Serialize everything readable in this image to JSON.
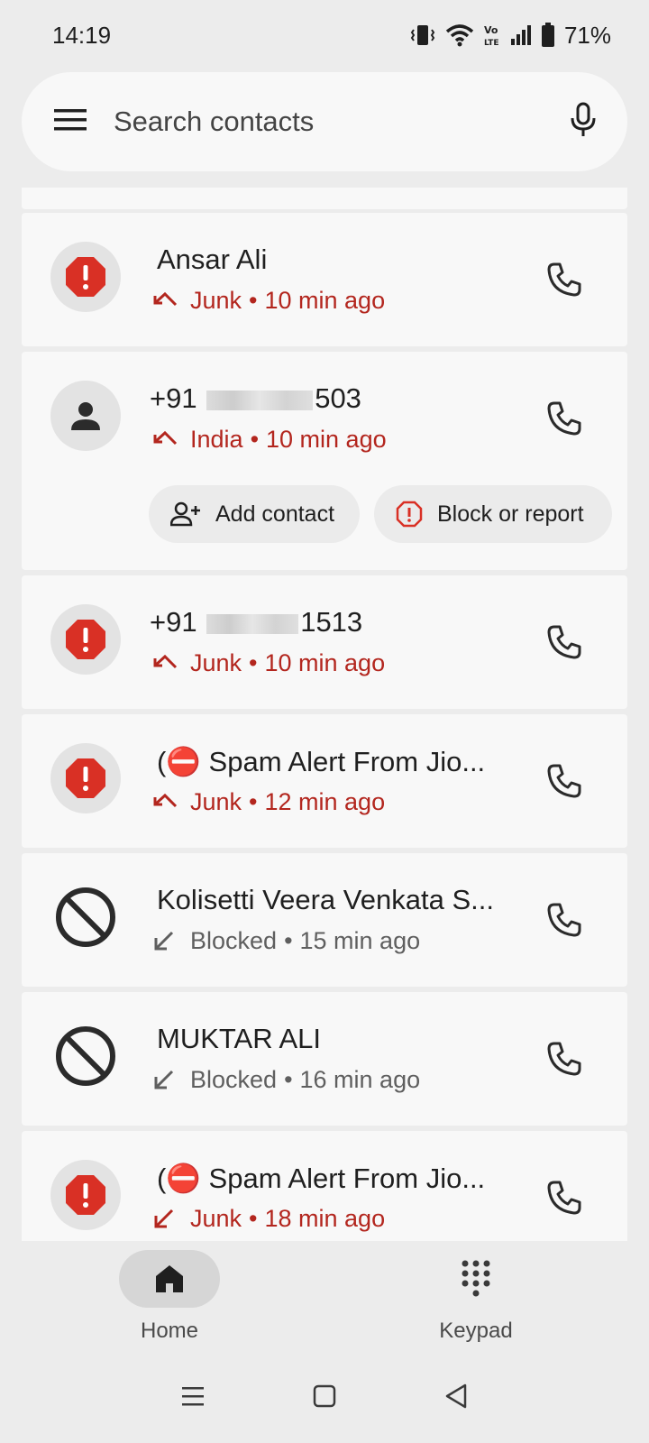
{
  "status_bar": {
    "time": "14:19",
    "battery": "71%",
    "icons": [
      "vibrate-icon",
      "wifi-icon",
      "volte-icon",
      "signal-icon",
      "battery-icon"
    ]
  },
  "search": {
    "placeholder": "Search contacts",
    "menu_icon": "menu-icon",
    "mic_icon": "mic-icon"
  },
  "calls": [
    {
      "name": "Ansar Ali",
      "label": "Junk",
      "time": "10 min ago",
      "type": "junk"
    },
    {
      "name_prefix": "+91 ",
      "name_suffix": "503",
      "label": "India",
      "time": "10 min ago",
      "type": "unknown",
      "actions": {
        "add_contact": "Add contact",
        "block_report": "Block or report"
      }
    },
    {
      "name_prefix": "+91 ",
      "name_suffix": "1513",
      "label": "Junk",
      "time": "10 min ago",
      "type": "junk"
    },
    {
      "name": "(⛔ Spam Alert From Jio...",
      "label": "Junk",
      "time": "12 min ago",
      "type": "junk"
    },
    {
      "name": "Kolisetti Veera Venkata S...",
      "label": "Blocked",
      "time": "15 min ago",
      "type": "blocked"
    },
    {
      "name": "MUKTAR ALI",
      "label": "Blocked",
      "time": "16 min ago",
      "type": "blocked"
    },
    {
      "name": "(⛔ Spam Alert From Jio...",
      "label": "Junk",
      "time": "18 min ago",
      "type": "junk"
    }
  ],
  "separator": "•",
  "nav": {
    "home": "Home",
    "keypad": "Keypad"
  },
  "colors": {
    "junk_red": "#b3261e",
    "alert_red": "#d93025",
    "card_bg": "#f8f8f8",
    "page_bg": "#ececec"
  }
}
